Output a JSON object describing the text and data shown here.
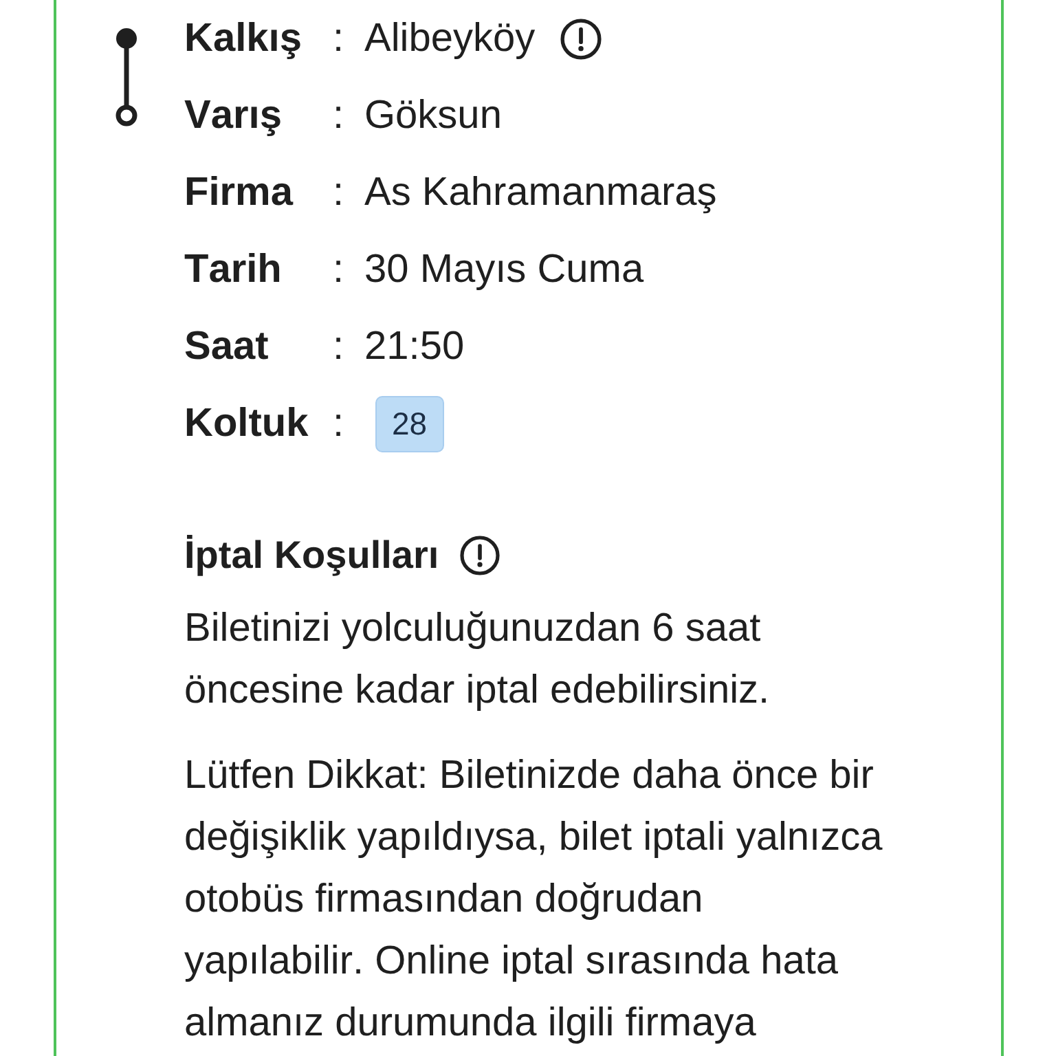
{
  "trip": {
    "rows": [
      {
        "kind": "origin",
        "label": "Kalkış",
        "colon": ":",
        "value": "Alibeyköy",
        "info_icon": true
      },
      {
        "kind": "destination",
        "label": "Varış",
        "colon": ":",
        "value": "Göksun"
      },
      {
        "kind": "detail",
        "label": "Firma",
        "colon": ":",
        "value": "As Kahramanmaraş"
      },
      {
        "kind": "detail",
        "label": "Tarih",
        "colon": ":",
        "value": "30 Mayıs Cuma"
      },
      {
        "kind": "detail",
        "label": "Saat",
        "colon": ":",
        "value": "21:50"
      },
      {
        "kind": "seat",
        "label": "Koltuk",
        "colon": ":",
        "value": "28"
      }
    ]
  },
  "cancellation": {
    "title": "İptal Koşulları",
    "info_icon": true,
    "paragraphs": [
      "Biletinizi yolculuğunuzdan 6 saat öncesine kadar iptal edebilirsiniz.",
      "Lütfen Dikkat: Biletinizde daha önce bir değişiklik yapıldıysa, bilet iptali yalnızca otobüs firmasından doğrudan yapılabilir. Online iptal sırasında hata almanız durumunda ilgili firmaya"
    ]
  }
}
